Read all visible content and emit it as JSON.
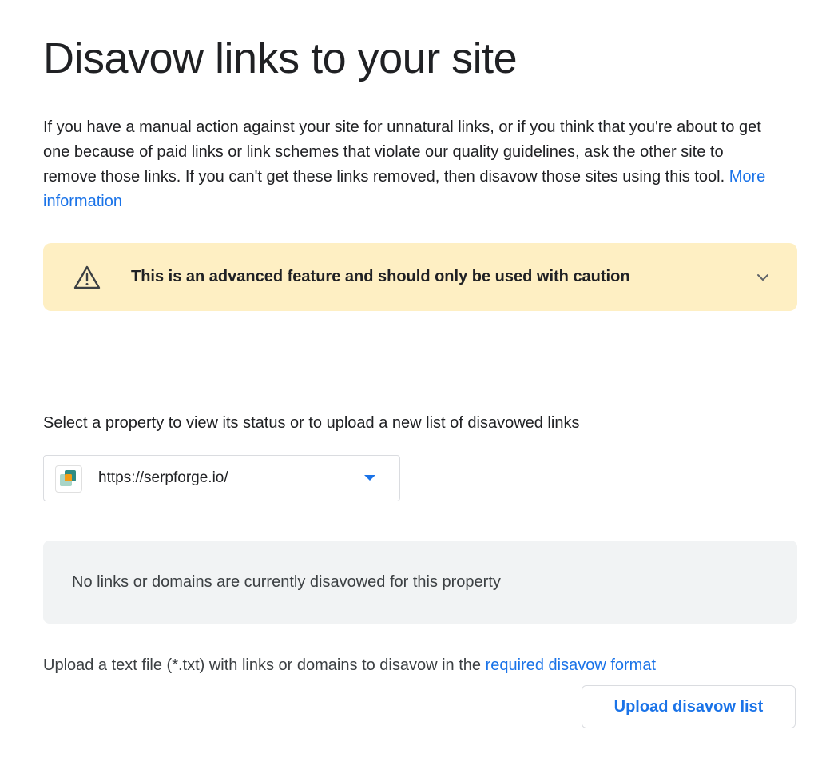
{
  "page": {
    "title": "Disavow links to your site",
    "intro_text": "If you have a manual action against your site for unnatural links, or if you think that you're about to get one because of paid links or link schemes that violate our quality guidelines, ask the other site to remove those links. If you can't get these links removed, then disavow those sites using this tool.",
    "more_info_link": "More information"
  },
  "warning": {
    "icon": "warning-triangle-icon",
    "text": "This is an advanced feature and should only be used with caution",
    "expand_icon": "chevron-down-icon"
  },
  "property": {
    "label": "Select a property to view its status or to upload a new list of disavowed links",
    "selected": "https://serpforge.io/",
    "dropdown_icon": "dropdown-arrow-icon"
  },
  "status": {
    "message": "No links or domains are currently disavowed for this property"
  },
  "upload": {
    "description": "Upload a text file (*.txt) with links or domains to disavow in the",
    "format_link": "required disavow format",
    "button_label": "Upload disavow list"
  },
  "colors": {
    "link": "#1a73e8",
    "warning_bg": "#feefc3",
    "status_bg": "#f1f3f4",
    "divider": "#dadce0"
  }
}
